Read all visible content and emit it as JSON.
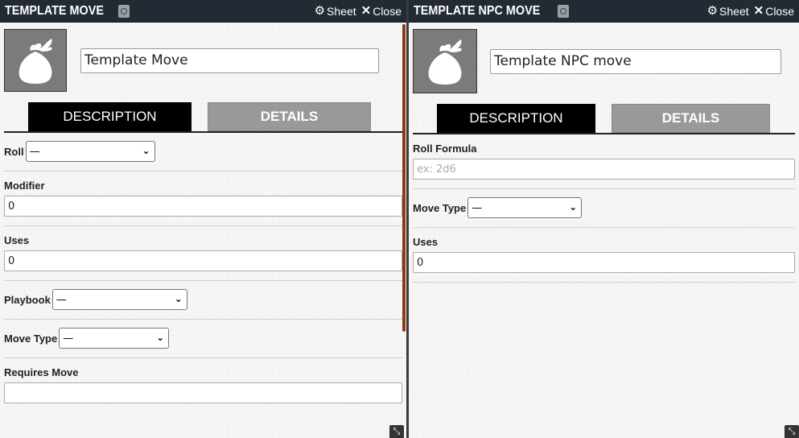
{
  "left": {
    "title": "TEMPLATE MOVE",
    "sheet_label": "Sheet",
    "close_label": "Close",
    "name_value": "Template Move",
    "tabs": [
      {
        "label": "DESCRIPTION"
      },
      {
        "label": "DETAILS"
      }
    ],
    "roll": {
      "label": "Roll",
      "value": "—"
    },
    "modifier": {
      "label": "Modifier",
      "value": "0"
    },
    "uses": {
      "label": "Uses",
      "value": "0"
    },
    "playbook": {
      "label": "Playbook",
      "value": "—"
    },
    "move_type": {
      "label": "Move Type",
      "value": "—"
    },
    "requires_move": {
      "label": "Requires Move",
      "value": ""
    }
  },
  "right": {
    "title": "TEMPLATE NPC MOVE",
    "sheet_label": "Sheet",
    "close_label": "Close",
    "name_value": "Template NPC move",
    "tabs": [
      {
        "label": "DESCRIPTION"
      },
      {
        "label": "DETAILS"
      }
    ],
    "roll_formula": {
      "label": "Roll Formula",
      "value": "",
      "placeholder": "ex: 2d6"
    },
    "move_type": {
      "label": "Move Type",
      "value": "—"
    },
    "uses": {
      "label": "Uses",
      "value": "0"
    }
  },
  "colors": {
    "titlebar": "#222a34",
    "tab_active": "#000000",
    "tab_inactive": "#999999",
    "scrollbar": "#8b3a1e"
  },
  "icons": [
    "gear-icon",
    "close-icon",
    "bag-icon",
    "document-badge-icon",
    "chevron-down-icon",
    "resize-icon"
  ]
}
